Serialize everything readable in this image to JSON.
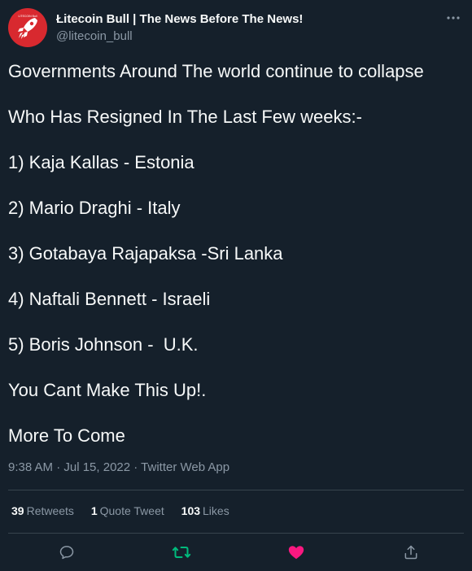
{
  "author": {
    "name": "Łitecoin Bull | The News Before The News!",
    "handle": "@litecoin_bull",
    "avatar_text": "LITECOIN Bull"
  },
  "tweet": {
    "lines": [
      "Governments Around The world continue to collapse",
      "Who Has Resigned In The Last Few weeks:-",
      "1) Kaja Kallas - Estonia",
      "2) Mario Draghi - Italy",
      "3) Gotabaya Rajapaksa -Sri Lanka",
      "4) Naftali Bennett - Israeli",
      "5) Boris Johnson -  U.K.",
      "You Cant Make This Up!.",
      "More To Come"
    ],
    "timestamp": "9:38 AM · Jul 15, 2022 · Twitter Web App"
  },
  "stats": {
    "retweets": {
      "count": "39",
      "label": "Retweets"
    },
    "quotes": {
      "count": "1",
      "label": "Quote Tweet"
    },
    "likes": {
      "count": "103",
      "label": "Likes"
    }
  },
  "actions": {
    "reply_icon": "reply-icon",
    "retweet_icon": "retweet-icon",
    "like_icon": "heart-icon",
    "share_icon": "share-icon"
  },
  "colors": {
    "background": "#15202b",
    "text": "#f7f9f9",
    "muted": "#8b98a5",
    "retweet": "#00ba7c",
    "like": "#f91880",
    "avatar": "#d8292f"
  }
}
